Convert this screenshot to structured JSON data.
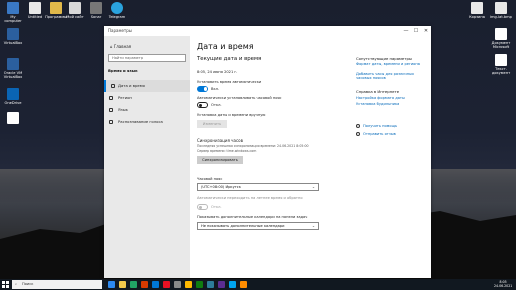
{
  "desktop_icons": [
    {
      "label": "My computer",
      "color": "#3a78c4"
    },
    {
      "label": "Untitled",
      "color": "#e8e8e8"
    },
    {
      "label": "Программы",
      "color": "#e0b84a"
    },
    {
      "label": "Мой сайт",
      "color": "#d9d9d9"
    },
    {
      "label": "Sonar",
      "color": "#777777"
    },
    {
      "label": "Telegram",
      "color": "#2aa3de"
    },
    {
      "label": "VirtualBox",
      "color": "#2b5f9e"
    },
    {
      "label": "Oracle VM VirtualBox",
      "color": "#2b5f9e"
    },
    {
      "label": "ОneDrive",
      "color": "#0a64b4"
    },
    {
      "label": "",
      "color": "#ffffff"
    },
    {
      "label": "Корзина",
      "color": "#e8e8e8"
    },
    {
      "label": "img-lat.bmp",
      "color": "#e8e8e8"
    },
    {
      "label": "Документ Microsoft",
      "color": "#ffffff"
    },
    {
      "label": "Текст. документ",
      "color": "#ffffff"
    }
  ],
  "window": {
    "title": "Параметры",
    "minimize": "—",
    "maximize": "☐",
    "close": "✕"
  },
  "sidebar": {
    "home": "Главная",
    "search_placeholder": "Найти параметр",
    "section": "Время и язык",
    "items": [
      {
        "label": "Дата и время",
        "active": true
      },
      {
        "label": "Регион",
        "active": false
      },
      {
        "label": "Язык",
        "active": false
      },
      {
        "label": "Распознавание голоса",
        "active": false
      }
    ]
  },
  "main": {
    "title": "Дата и время",
    "subtitle": "Текущие дата и время",
    "current_datetime": "8:05, 24 июня 2021 г.",
    "auto_time_label": "Установить время автоматически",
    "auto_time_state": "Вкл.",
    "auto_tz_label": "Автоматически устанавливать часовой пояс",
    "auto_tz_state": "Откл.",
    "manual_label": "Установка даты и времени вручную",
    "manual_button": "Изменить",
    "sync_heading": "Синхронизация часов",
    "sync_info_1": "Последняя успешная синхронизация времени: 24.06.2021 8:05:00",
    "sync_info_2": "Сервер времени: time.windows.com",
    "sync_button": "Синхронизировать",
    "tz_label": "Часовой пояс",
    "tz_value": "(UTC+08:00) Иркутск",
    "dst_label": "Автоматически переходить на летнее время и обратно",
    "dst_state": "Откл.",
    "calendar_label": "Показывать дополнительные календари на панели задач",
    "calendar_value": "Не показывать дополнительные календари",
    "chevron": "⌄"
  },
  "related": {
    "heading": "Сопутствующие параметры",
    "links": [
      "Формат даты, времени и региона",
      "Добавить часы для различных часовых поясов"
    ],
    "help_heading": "Справка в Интернете",
    "help_links": [
      "Настройка формата даты",
      "Установка будильника"
    ],
    "feedback": "Получить помощь",
    "send_feedback": "Отправить отзыв"
  },
  "taskbar": {
    "search_placeholder": "Поиск",
    "apps": [
      "#2d89ef",
      "#f2c94c",
      "#21a366",
      "#d83b01",
      "#0078d7",
      "#e81123",
      "#8a8a8a",
      "#ffb900",
      "#107c10",
      "#2d7d9a",
      "#5c2d91",
      "#00a4ef",
      "#ff8c00"
    ],
    "time": "8:05",
    "date": "24.06.2021"
  }
}
